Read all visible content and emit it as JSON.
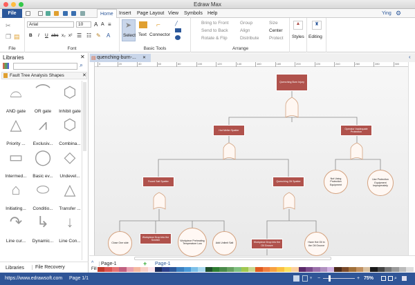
{
  "app": {
    "title": "Edraw Max"
  },
  "menu": {
    "file": "File",
    "tabs": [
      "Home",
      "Insert",
      "Page Layout",
      "View",
      "Symbols",
      "Help"
    ],
    "user": "Ying"
  },
  "ribbon": {
    "file_group": "File",
    "font": {
      "family": "Arial",
      "size": "10",
      "label": "Font"
    },
    "basic_tools": {
      "select": "Select",
      "text": "Text",
      "connector": "Connector",
      "label": "Basic Tools"
    },
    "arrange": {
      "bring_front": "Bring to Front",
      "send_back": "Send to Back",
      "rotate": "Rotate & Flip",
      "group": "Group",
      "align": "Align",
      "distribute": "Distribute",
      "size": "Size",
      "center": "Center",
      "protect": "Protect",
      "label": "Arrange"
    },
    "styles": "Styles",
    "editing": "Editing"
  },
  "libraries": {
    "title": "Libraries",
    "search_value": "",
    "category": "Fault Tree Analysis Shapes",
    "shapes": [
      "AND gate",
      "OR gate",
      "Inhibit gate",
      "Priority ...",
      "Exclusiv...",
      "Combina...",
      "Intermed...",
      "Basic ev...",
      "Undevel...",
      "Initiating...",
      "Conditio...",
      "Transfer ...",
      "Line cur...",
      "Dynamic...",
      "Line Con..."
    ],
    "bottom_tabs": [
      "Libraries",
      "File Recovery"
    ]
  },
  "document": {
    "tab": "quenching-burn-...",
    "ruler": [
      "0",
      "20",
      "40",
      "60",
      "80",
      "100",
      "120",
      "140",
      "160",
      "180",
      "200",
      "220",
      "240",
      "260",
      "280",
      "300"
    ]
  },
  "diagram": {
    "top": "Quenching Burn Injury",
    "hot_melter": "Hot Melter Spatter",
    "operator": "Operator Inadequate Protection",
    "fused_salt": "Fused Salt Spatter",
    "quenching_oil": "Quenching Oil Spatter",
    "not_using": "Not Using Protection Equipment",
    "use_improperly": "Use Protection Equipment Improperately",
    "close_one": "Close One side",
    "drop_smelter": "Workpiece Drop into the Smelter",
    "preheat": "Workpiece Preheating Temperature Low",
    "add_salt": "Add Unlimit Salt",
    "drop_oil": "Workpiece Drop into the Oil Groove",
    "hot_oil": "Have Hot Oil in the Oil Groove"
  },
  "pages": {
    "current": "Page-1",
    "tab": "Page-1",
    "fill_label": "Fill"
  },
  "status": {
    "url": "https://www.edrawsoft.com",
    "page": "Page 1/1",
    "zoom": "75%"
  },
  "colors": {
    "accent": "#2b579a",
    "node": "#b0524c",
    "status": "#2f5597"
  }
}
